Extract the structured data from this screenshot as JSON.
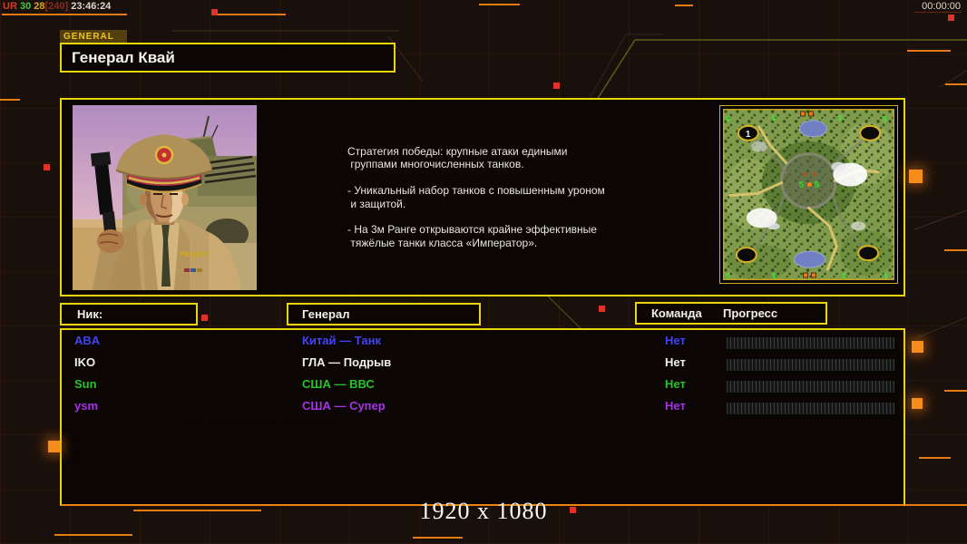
{
  "hud": {
    "debug": {
      "ur": "UR",
      "v1": "30",
      "v2": "28",
      "v3": "[240]",
      "time": "23:46:24"
    },
    "debug_colors": {
      "ur": "#d23b28",
      "v1": "#3fc93f",
      "v2": "#d8a61f",
      "v3": "#8a2a1e",
      "time": "#ded6cc"
    },
    "match_timer": "00:00:00"
  },
  "header": {
    "tab_label": "GENERAL",
    "title": "Генерал Квай"
  },
  "general_info": {
    "description": "Стратегия победы: крупные атаки едиными\n группами многочисленных танков.\n\n- Уникальный набор танков с повышенным уроном\n и защитой.\n\n- На 3м Ранге открываются крайне эффективные\n тяжёлые танки класса «Император»."
  },
  "minimap": {
    "start_label": "1",
    "supply_symbol": "$",
    "supply_center": "S"
  },
  "columns": {
    "nick": "Ник:",
    "general": "Генерал",
    "team": "Команда",
    "progress": "Прогресс"
  },
  "players": [
    {
      "name": "ABA",
      "general": "Китай — Танк",
      "team": "Нет",
      "progress": 0,
      "color": "#4343f5"
    },
    {
      "name": "IKO",
      "general": "ГЛА — Подрыв",
      "team": "Нет",
      "progress": 0,
      "color": "#f0eeee"
    },
    {
      "name": "Sun",
      "general": "США — ВВС",
      "team": "Нет",
      "progress": 0,
      "color": "#28c228"
    },
    {
      "name": "ysm",
      "general": "США — Супер",
      "team": "Нет",
      "progress": 0,
      "color": "#a632e6"
    }
  ],
  "footer": {
    "resolution": "1920 x 1080"
  },
  "accent_colors": {
    "border_yellow": "#e8d50a",
    "deco_orange": "#e57b12",
    "deco_red": "#e03228"
  }
}
